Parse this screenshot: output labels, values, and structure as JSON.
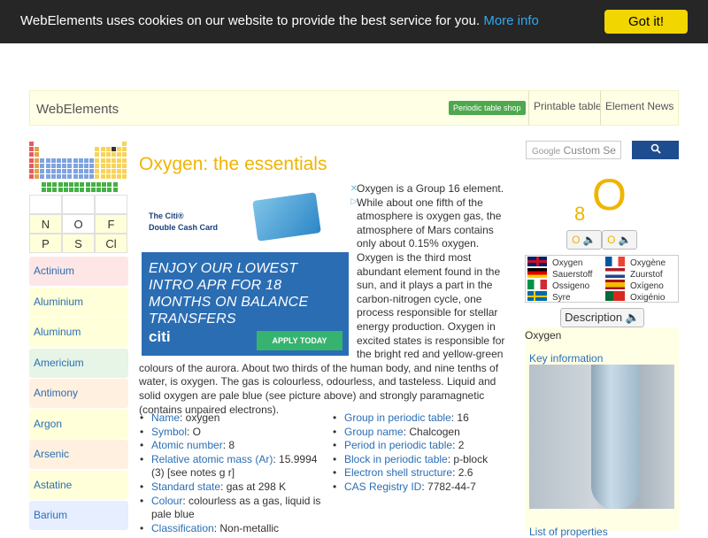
{
  "cookie": {
    "message": "WebElements uses cookies on our website to provide the best service for you.",
    "more_info": "More info",
    "got_it": "Got it!"
  },
  "header": {
    "brand": "WebElements",
    "shop_label": "Periodic table shop",
    "printable": "Printable table",
    "news": "Element News"
  },
  "mini_table": [
    "N",
    "O",
    "F",
    "P",
    "S",
    "Cl"
  ],
  "element_list": [
    {
      "label": "Actinium",
      "color": "#ffe6e6"
    },
    {
      "label": "Aluminium",
      "color": "#ffffd9"
    },
    {
      "label": "Aluminum",
      "color": "#ffffd9"
    },
    {
      "label": "Americium",
      "color": "#e6f5e6"
    },
    {
      "label": "Antimony",
      "color": "#fff0e0"
    },
    {
      "label": "Argon",
      "color": "#ffffd9"
    },
    {
      "label": "Arsenic",
      "color": "#fff0e0"
    },
    {
      "label": "Astatine",
      "color": "#ffffd9"
    },
    {
      "label": "Barium",
      "color": "#e6eeff"
    }
  ],
  "main": {
    "title": "Oxygen: the essentials",
    "intro": "Oxygen is a Group 16 element. While about one fifth of the atmosphere is oxygen gas, the atmosphere of Mars contains only about 0.15% oxygen. Oxygen is the third most abundant element found in the sun, and it plays a part in the carbon-nitrogen cycle, one process responsible for stellar energy production. Oxygen in excited states is responsible for the bright red and yellow-green colours of the aurora. About two thirds of the human body, and nine tenths of water, is oxygen. The gas is colourless, odourless, and tasteless. Liquid and solid oxygen are pale blue (see picture above) and strongly paramagnetic (contains unpaired electrons)."
  },
  "ad": {
    "brand_line1": "The Citi®",
    "brand_line2": "Double Cash Card",
    "headline": "ENJOY OUR LOWEST INTRO APR FOR 18 MONTHS ON BALANCE TRANSFERS",
    "logo": "citi",
    "cta": "APPLY TODAY",
    "close": "✕",
    "info": "▷"
  },
  "properties_left": [
    {
      "key": "Name",
      "value": ": oxygen"
    },
    {
      "key": "Symbol",
      "value": ": O"
    },
    {
      "key": "Atomic number",
      "value": ": 8"
    },
    {
      "key": "Relative atomic mass (Ar)",
      "value": ": 15.9994 (3) [see notes g r]"
    },
    {
      "key": "Standard state",
      "value": ": gas at 298 K"
    },
    {
      "key": "Colour",
      "value": ": colourless as a gas, liquid is pale blue"
    },
    {
      "key": "Classification",
      "value": ": Non-metallic"
    }
  ],
  "properties_right": [
    {
      "key": "Group in periodic table",
      "value": ": 16"
    },
    {
      "key": "Group name",
      "value": ": Chalcogen"
    },
    {
      "key": "Period in periodic table",
      "value": ": 2"
    },
    {
      "key": "Block in periodic table",
      "value": ": p-block"
    },
    {
      "key": "Electron shell structure",
      "value": ": 2.6"
    },
    {
      "key": "CAS Registry ID",
      "value": ": 7782-44-7"
    }
  ],
  "sidebar_right": {
    "search_placeholder": "Custom Se",
    "search_brand": "Google",
    "search_icon": "search-icon",
    "atomic_number": "8",
    "symbol": "O",
    "audio_label": "O",
    "languages": [
      {
        "name": "Oxygen",
        "flag": "uk"
      },
      {
        "name": "Oxygène",
        "flag": "fr"
      },
      {
        "name": "Sauerstoff",
        "flag": "de"
      },
      {
        "name": "Zuurstof",
        "flag": "nl"
      },
      {
        "name": "Ossigeno",
        "flag": "it"
      },
      {
        "name": "Oxígeno",
        "flag": "es"
      },
      {
        "name": "Syre",
        "flag": "se"
      },
      {
        "name": "Oxigénio",
        "flag": "pt"
      }
    ],
    "description_label": "Description",
    "element_name": "Oxygen",
    "key_info": "Key information",
    "list_props": "List of properties"
  },
  "colors": {
    "accent": "#f0b400",
    "link": "#2a6eb5",
    "cookie_bg": "#262626",
    "cookie_btn": "#f1d600",
    "panel_bg": "#ffffe6"
  }
}
